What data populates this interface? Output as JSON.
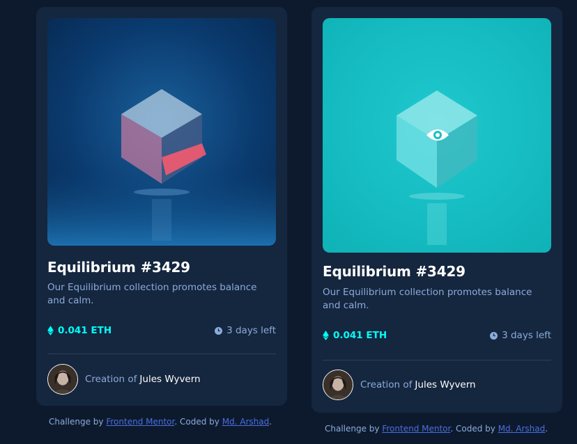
{
  "cards": [
    {
      "title": "Equilibrium #3429",
      "description": "Our Equilibrium collection promotes balance and calm.",
      "price": "0.041 ETH",
      "time_left": "3 days left",
      "creator_prefix": "Creation of",
      "creator_name": "Jules Wyvern",
      "state": "default",
      "icons": {
        "price": "ethereum-icon",
        "time": "clock-icon"
      }
    },
    {
      "title": "Equilibrium #3429",
      "description": "Our Equilibrium collection promotes balance and calm.",
      "price": "0.041 ETH",
      "time_left": "3 days left",
      "creator_prefix": "Creation of",
      "creator_name": "Jules Wyvern",
      "state": "hover",
      "overlay_icon": "eye-icon",
      "icons": {
        "price": "ethereum-icon",
        "time": "clock-icon"
      }
    }
  ],
  "attribution": {
    "prefix": "Challenge by",
    "link1": "Frontend Mentor",
    "middle": ". Coded by",
    "link2": "Md. Arshad",
    "suffix": "."
  },
  "colors": {
    "page_bg": "#0d1a2e",
    "card_bg": "#15263f",
    "accent_cyan": "#00fff8",
    "muted_text": "#8bacd9",
    "link": "#4a6ee0"
  }
}
